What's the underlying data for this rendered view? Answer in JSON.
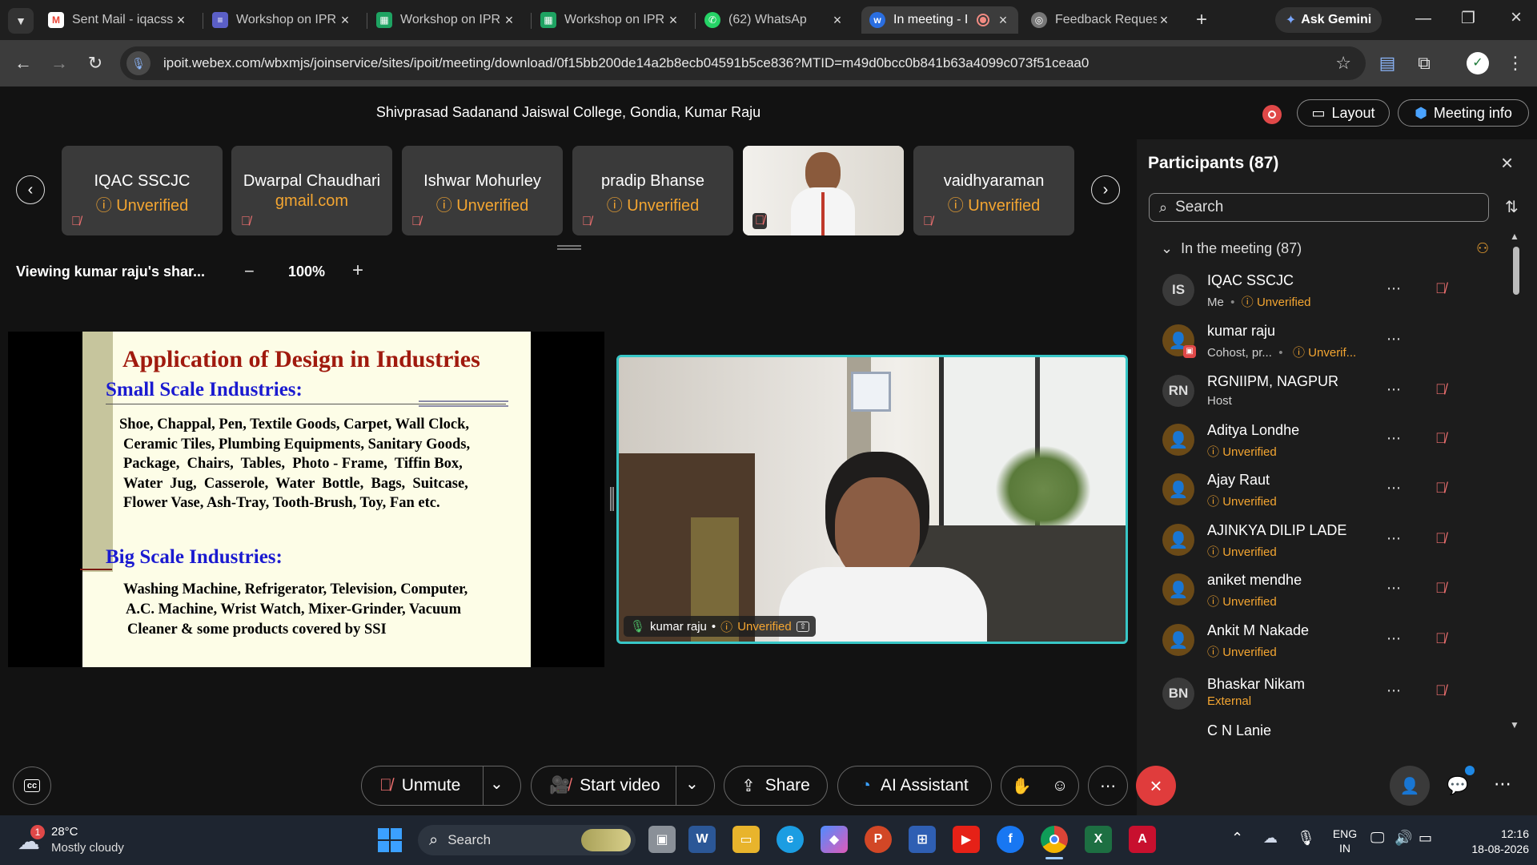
{
  "tabs": [
    {
      "title": "Sent Mail - iqacss",
      "icon": "gmail-icon"
    },
    {
      "title": "Workshop on IPR",
      "icon": "forms-icon"
    },
    {
      "title": "Workshop on IPR",
      "icon": "sheets-icon"
    },
    {
      "title": "Workshop on IPR",
      "icon": "sheets-icon"
    },
    {
      "title": "(62) WhatsAp",
      "icon": "whatsapp-icon"
    },
    {
      "title": "In meeting - I",
      "icon": "webex-icon"
    },
    {
      "title": "Feedback Reques",
      "icon": "feedback-icon"
    }
  ],
  "browser": {
    "ask_gemini": "Ask Gemini",
    "url": "ipoit.webex.com/wbxmjs/joinservice/sites/ipoit/meeting/download/0f15bb200de14a2b8ecb04591b5ce836?MTID=m49d0bcc0b841b63a4099c073f51ceaa0"
  },
  "meeting": {
    "title": "Shivprasad Sadanand Jaiswal College, Gondia, Kumar Raju",
    "layout_label": "Layout",
    "meeting_info_label": "Meeting info",
    "viewing_label": "Viewing kumar raju's shar...",
    "zoom_level": "100%",
    "zoom_minus": "−",
    "zoom_plus": "+"
  },
  "tiles": [
    {
      "name": "IQAC SSCJC",
      "status": "ⓘ Unverified"
    },
    {
      "name": "Dwarpal Chaudhari",
      "status": "gmail.com"
    },
    {
      "name": "Ishwar Mohurley",
      "status": "ⓘ Unverified"
    },
    {
      "name": "pradip Bhanse",
      "status": "ⓘ Unverified"
    },
    {
      "name": "",
      "status": ""
    },
    {
      "name": "vaidhyaraman",
      "status": "ⓘ Unverified"
    }
  ],
  "slide": {
    "title": "Application of Design in Industries",
    "section1": "Small Scale Industries:",
    "section1_lines": [
      "Shoe, Chappal, Pen, Textile Goods, Carpet, Wall Clock,",
      "Ceramic Tiles, Plumbing Equipments, Sanitary Goods,",
      "Package,  Chairs,  Tables,  Photo - Frame,  Tiffin Box,",
      "Water  Jug,  Casserole,  Water  Bottle,  Bags,  Suitcase,",
      "Flower Vase, Ash-Tray, Tooth-Brush, Toy, Fan etc."
    ],
    "section2": "Big Scale Industries:",
    "section2_lines": [
      "Washing Machine, Refrigerator, Television, Computer,",
      "A.C. Machine, Wrist Watch, Mixer-Grinder, Vacuum",
      "Cleaner & some products covered by SSI"
    ]
  },
  "video": {
    "name": "kumar raju",
    "status": "Unverified"
  },
  "participants": {
    "title": "Participants (87)",
    "search_placeholder": "Search",
    "group_label": "In the meeting (87)",
    "list": [
      {
        "initials": "IS",
        "name": "IQAC SSCJC",
        "role": "Me",
        "status": "Unverified",
        "muted": true
      },
      {
        "initials": "",
        "name": "kumar raju",
        "role": "Cohost, pr...",
        "status": "Unverif...",
        "muted": false
      },
      {
        "initials": "RN",
        "name": "RGNIIPM, NAGPUR",
        "role": "Host",
        "status": "",
        "muted": true
      },
      {
        "initials": "",
        "name": "Aditya Londhe",
        "role": "",
        "status": "Unverified",
        "muted": true
      },
      {
        "initials": "",
        "name": "Ajay Raut",
        "role": "",
        "status": "Unverified",
        "muted": true
      },
      {
        "initials": "",
        "name": "AJINKYA DILIP LADE",
        "role": "",
        "status": "Unverified",
        "muted": true
      },
      {
        "initials": "",
        "name": "aniket mendhe",
        "role": "",
        "status": "Unverified",
        "muted": true
      },
      {
        "initials": "",
        "name": "Ankit M Nakade",
        "role": "",
        "status": "Unverified",
        "muted": true
      },
      {
        "initials": "BN",
        "name": "Bhaskar Nikam",
        "role": "",
        "status": "External",
        "muted": true
      },
      {
        "initials": "",
        "name": "C N Lanje",
        "role": "",
        "status": "",
        "muted": false
      }
    ]
  },
  "controls": {
    "unmute": "Unmute",
    "start_video": "Start video",
    "share": "Share",
    "ai_assistant": "AI Assistant"
  },
  "taskbar": {
    "weather_temp": "28°C",
    "weather_desc": "Mostly cloudy",
    "weather_badge": "1",
    "search": "Search",
    "lang1": "ENG",
    "lang2": "IN",
    "time": "12:16",
    "date": "18-08-2026"
  }
}
